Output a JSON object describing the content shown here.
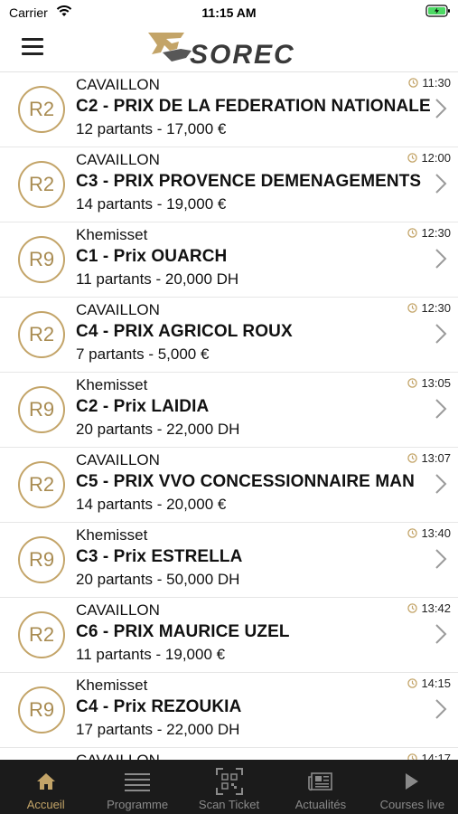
{
  "status": {
    "carrier": "Carrier",
    "time": "11:15 AM"
  },
  "header": {
    "logo_text": "SOREC"
  },
  "races": [
    {
      "badge": "R2",
      "venue": "CAVAILLON",
      "name": "C2 - PRIX DE LA FEDERATION NATIONALE",
      "details": "12 partants - 17,000 €",
      "time": "11:30"
    },
    {
      "badge": "R2",
      "venue": "CAVAILLON",
      "name": "C3 - PRIX PROVENCE DEMENAGEMENTS",
      "details": "14 partants - 19,000 €",
      "time": "12:00"
    },
    {
      "badge": "R9",
      "venue": "Khemisset",
      "name": "C1 - Prix OUARCH",
      "details": "11 partants - 20,000 DH",
      "time": "12:30"
    },
    {
      "badge": "R2",
      "venue": "CAVAILLON",
      "name": "C4 - PRIX AGRICOL ROUX",
      "details": "7 partants - 5,000 €",
      "time": "12:30"
    },
    {
      "badge": "R9",
      "venue": "Khemisset",
      "name": "C2 - Prix LAIDIA",
      "details": "20 partants - 22,000 DH",
      "time": "13:05"
    },
    {
      "badge": "R2",
      "venue": "CAVAILLON",
      "name": "C5 - PRIX VVO CONCESSIONNAIRE MAN",
      "details": "14 partants - 20,000 €",
      "time": "13:07"
    },
    {
      "badge": "R9",
      "venue": "Khemisset",
      "name": "C3 - Prix ESTRELLA",
      "details": "20 partants - 50,000 DH",
      "time": "13:40"
    },
    {
      "badge": "R2",
      "venue": "CAVAILLON",
      "name": "C6 - PRIX MAURICE UZEL",
      "details": "11 partants - 19,000 €",
      "time": "13:42"
    },
    {
      "badge": "R9",
      "venue": "Khemisset",
      "name": "C4 - Prix REZOUKIA",
      "details": "17 partants - 22,000 DH",
      "time": "14:15"
    },
    {
      "badge": "",
      "venue": "CAVAILLON",
      "name": "",
      "details": "",
      "time": "14:17"
    }
  ],
  "tabs": [
    {
      "label": "Accueil",
      "icon": "home-icon",
      "active": true
    },
    {
      "label": "Programme",
      "icon": "list-icon",
      "active": false
    },
    {
      "label": "Scan Ticket",
      "icon": "qr-scan-icon",
      "active": false
    },
    {
      "label": "Actualités",
      "icon": "newspaper-icon",
      "active": false
    },
    {
      "label": "Courses live",
      "icon": "play-icon",
      "active": false
    }
  ],
  "colors": {
    "accent_gold": "#c3a468",
    "tab_bar_bg": "#1b1b1b",
    "tab_inactive": "#8a8a8a"
  }
}
